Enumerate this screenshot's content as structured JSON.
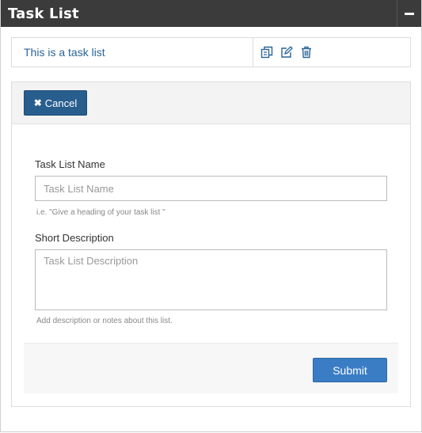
{
  "header": {
    "title": "Task List",
    "toggle_icon": "minus-icon"
  },
  "task_list": {
    "name": "This is a task list",
    "actions": [
      "copy-icon",
      "edit-icon",
      "trash-icon"
    ]
  },
  "form": {
    "cancel_label": "Cancel",
    "cancel_icon": "close-icon",
    "name_label": "Task List Name",
    "name_placeholder": "Task List Name",
    "name_value": "",
    "name_help": "i.e. \"Give a heading of your task list \"",
    "desc_label": "Short Description",
    "desc_placeholder": "Task List Description",
    "desc_value": "",
    "desc_help": "Add description or notes about this list.",
    "submit_label": "Submit"
  },
  "colors": {
    "header_bg": "#3b3b3b",
    "link": "#2a6496",
    "cancel_bg": "#285e8e",
    "submit_bg": "#3a7dc4"
  }
}
